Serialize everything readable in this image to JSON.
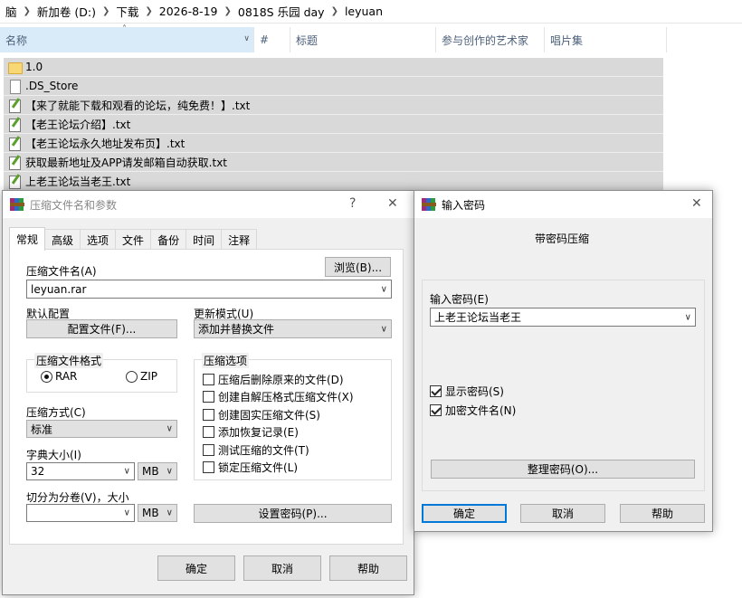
{
  "explorer": {
    "breadcrumb": [
      "脑",
      "新加卷 (D:)",
      "下载",
      "2026-8-19",
      "0818S 乐园 day",
      "leyuan"
    ],
    "columns": [
      "名称",
      "#",
      "标题",
      "参与创作的艺术家",
      "唱片集"
    ],
    "files": [
      {
        "name": "1.0",
        "icon": "folder-icon"
      },
      {
        "name": ".DS_Store",
        "icon": "file-icon"
      },
      {
        "name": "【来了就能下载和观看的论坛，纯免费！】.txt",
        "icon": "text-file-icon"
      },
      {
        "name": "【老王论坛介绍】.txt",
        "icon": "text-file-icon"
      },
      {
        "name": "【老王论坛永久地址发布页】.txt",
        "icon": "text-file-icon"
      },
      {
        "name": "获取最新地址及APP请发邮箱自动获取.txt",
        "icon": "text-file-icon"
      },
      {
        "name": "上老王论坛当老王.txt",
        "icon": "text-file-icon"
      }
    ]
  },
  "archive_dialog": {
    "title": "压缩文件名和参数",
    "help": "?",
    "close": "✕",
    "tabs": [
      "常规",
      "高级",
      "选项",
      "文件",
      "备份",
      "时间",
      "注释"
    ],
    "archive_name_label": "压缩文件名(A)",
    "browse_button": "浏览(B)...",
    "archive_name_value": "leyuan.rar",
    "default_profile_label": "默认配置",
    "profiles_button": "配置文件(F)...",
    "update_mode_label": "更新模式(U)",
    "update_mode_value": "添加并替换文件",
    "format_group": "压缩文件格式",
    "format_rar": "RAR",
    "format_zip": "ZIP",
    "format_selected": "RAR",
    "options_group": "压缩选项",
    "options": [
      {
        "label": "压缩后删除原来的文件(D)",
        "checked": false
      },
      {
        "label": "创建自解压格式压缩文件(X)",
        "checked": false
      },
      {
        "label": "创建固实压缩文件(S)",
        "checked": false
      },
      {
        "label": "添加恢复记录(E)",
        "checked": false
      },
      {
        "label": "测试压缩的文件(T)",
        "checked": false
      },
      {
        "label": "锁定压缩文件(L)",
        "checked": false
      }
    ],
    "method_label": "压缩方式(C)",
    "method_value": "标准",
    "dict_label": "字典大小(I)",
    "dict_value": "32",
    "dict_unit": "MB",
    "split_label": "切分为分卷(V)，大小",
    "split_value": "",
    "split_unit": "MB",
    "set_password_button": "设置密码(P)...",
    "ok_button": "确定",
    "cancel_button": "取消",
    "help_button": "帮助"
  },
  "password_dialog": {
    "title": "输入密码",
    "close": "✕",
    "heading": "带密码压缩",
    "password_label": "输入密码(E)",
    "password_value": "上老王论坛当老王",
    "show_password": {
      "label": "显示密码(S)",
      "checked": true
    },
    "encrypt_names": {
      "label": "加密文件名(N)",
      "checked": true
    },
    "organize_button": "整理密码(O)...",
    "ok_button": "确定",
    "cancel_button": "取消",
    "help_button": "帮助"
  },
  "colors": {
    "accent": "#0078d7",
    "selected_row": "#d9d9d9",
    "dialog_bg": "#f0f0f0"
  }
}
